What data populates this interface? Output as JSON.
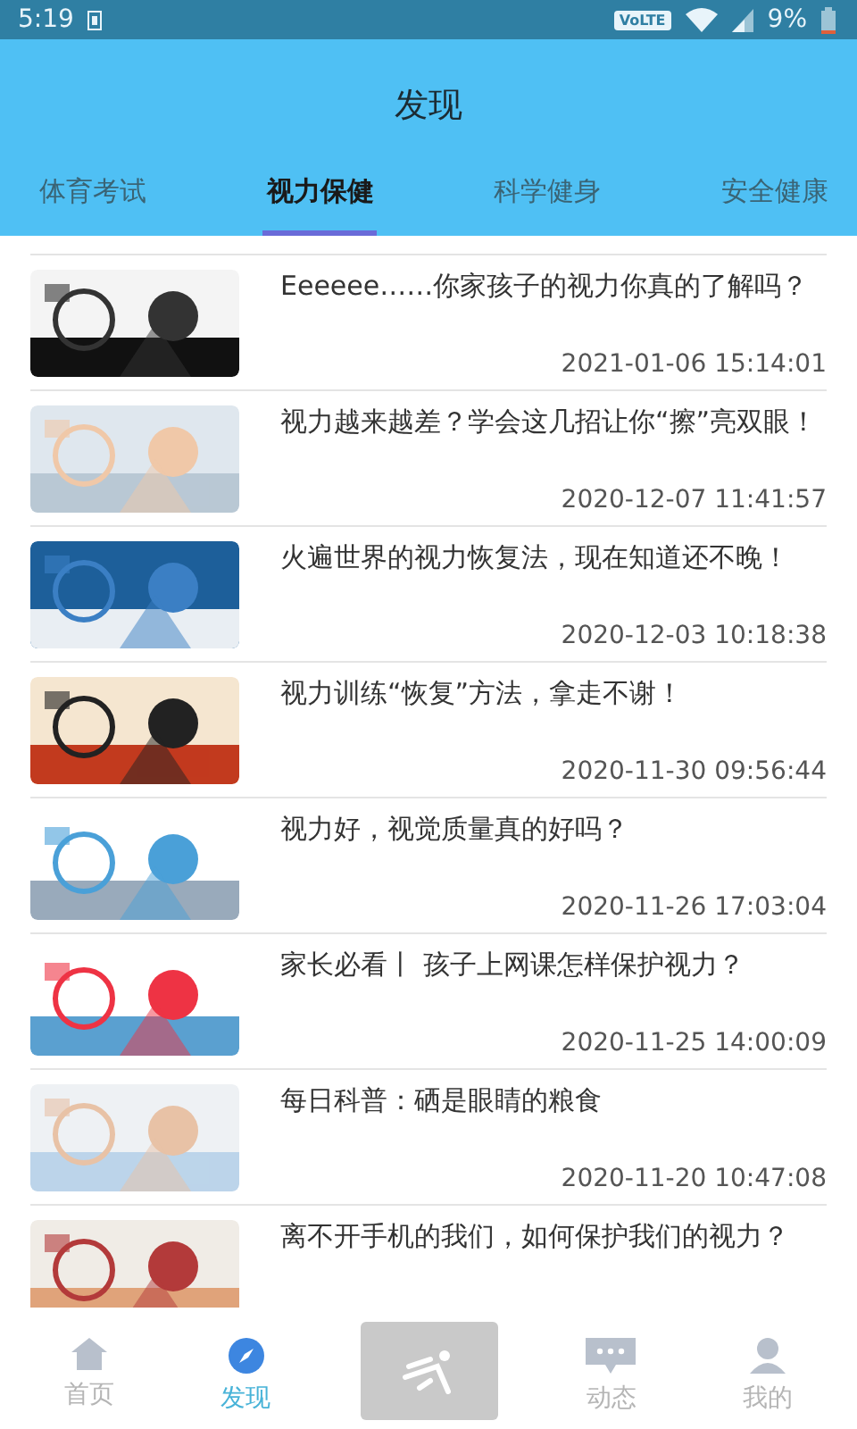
{
  "status_bar": {
    "time": "5:19",
    "network_badge": "VoLTE",
    "battery": "9%"
  },
  "header": {
    "title": "发现"
  },
  "tabs": [
    {
      "label": "体育考试",
      "selected": false
    },
    {
      "label": "视力保健",
      "selected": true
    },
    {
      "label": "科学健身",
      "selected": false
    },
    {
      "label": "安全健康",
      "selected": false
    }
  ],
  "articles": [
    {
      "title": "Eeeeee……你家孩子的视力你真的了解吗？",
      "date": "2021-01-06 15:14:01"
    },
    {
      "title": "视力越来越差？学会这几招让你“擦”亮双眼！",
      "date": "2020-12-07 11:41:57"
    },
    {
      "title": "火遍世界的视力恢复法，现在知道还不晚！",
      "date": "2020-12-03 10:18:38"
    },
    {
      "title": "视力训练“恢复”方法，拿走不谢！",
      "date": "2020-11-30 09:56:44"
    },
    {
      "title": "视力好，视觉质量真的好吗？",
      "date": "2020-11-26 17:03:04"
    },
    {
      "title": "家长必看丨 孩子上网课怎样保护视力？",
      "date": "2020-11-25 14:00:09"
    },
    {
      "title": "每日科普：硒是眼睛的粮食",
      "date": "2020-11-20 10:47:08"
    },
    {
      "title": "离不开手机的我们，如何保护我们的视力？"
    }
  ],
  "bottom_nav": [
    {
      "kind": "tab",
      "label": "首页",
      "selected": false
    },
    {
      "kind": "tab",
      "label": "发现",
      "selected": true
    },
    {
      "kind": "center"
    },
    {
      "kind": "tab",
      "label": "动态",
      "selected": false
    },
    {
      "kind": "tab",
      "label": "我的",
      "selected": false
    }
  ]
}
